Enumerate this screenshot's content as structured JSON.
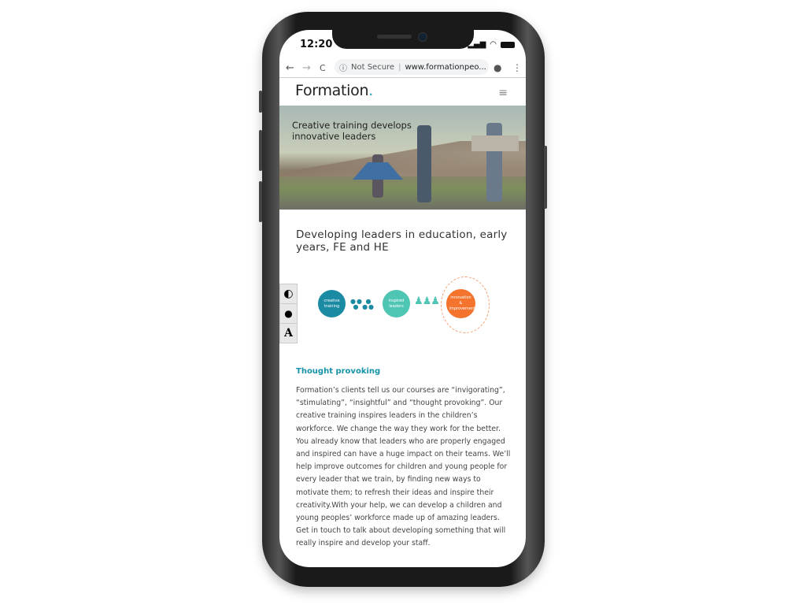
{
  "status_bar": {
    "time": "12:20",
    "icons": [
      "signal-icon",
      "wifi-icon",
      "battery-icon"
    ]
  },
  "browser": {
    "security": "Not Secure",
    "url": "www.formationpeo...",
    "back": "←",
    "forward": "→",
    "reload": "C",
    "info": "ⓘ",
    "star": "☆",
    "profile": "●",
    "more": "⋮"
  },
  "site": {
    "logo": "Formation",
    "logo_dot": ".",
    "menu": "≡"
  },
  "hero": {
    "text": "Creative training develops innovative leaders"
  },
  "heading": "Developing leaders in education, early years, FE and HE",
  "accessibility": {
    "contrast": "◐",
    "color": "💧",
    "font": "A"
  },
  "diagram": {
    "step1": "creative training",
    "step2": "inspired leaders",
    "step3": "innovation & improvement",
    "colors": {
      "step1": "#1b8ba4",
      "step2": "#4fc5b4",
      "step3": "#f4742e"
    }
  },
  "section": {
    "title": "Thought provoking",
    "body": "Formation’s clients tell us our courses are “invigorating”, “stimulating”, “insightful” and “thought provoking”. Our creative training inspires leaders in the children’s workforce. We change the way they work for the better. You already know that leaders who are properly engaged and inspired can have a huge impact on their teams. We’ll help improve outcomes for children and young people for every leader that we train, by finding new ways to motivate them; to refresh their ideas and inspire their creativity.With your help, we can develop a children and young peoples’ workforce made up of amazing leaders. Get in touch to talk about developing something that will really inspire and develop your staff."
  }
}
